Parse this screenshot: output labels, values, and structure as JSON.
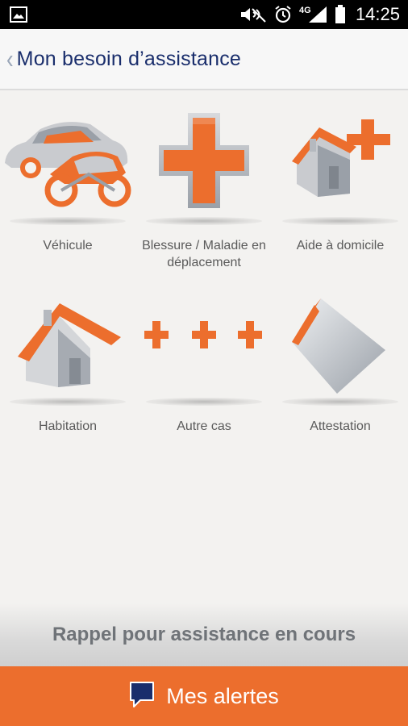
{
  "status_bar": {
    "time": "14:25",
    "network": "4G",
    "icons": [
      "image-icon",
      "mute-icon",
      "alarm-icon",
      "signal-icon",
      "battery-icon"
    ]
  },
  "header": {
    "back_icon": "chevron-left-icon",
    "title": "Mon besoin d’assistance"
  },
  "tiles": [
    {
      "label": "Véhicule",
      "icon": "vehicle-icon"
    },
    {
      "label": "Blessure / Maladie en déplacement",
      "icon": "medical-cross-icon"
    },
    {
      "label": "Aide à domicile",
      "icon": "home-help-icon"
    },
    {
      "label": "Habitation",
      "icon": "house-icon"
    },
    {
      "label": "Autre cas",
      "icon": "crosses-icon"
    },
    {
      "label": "Attestation",
      "icon": "document-icon"
    }
  ],
  "recall_text": "Rappel pour assistance en cours",
  "alerts_button": {
    "label": "Mes alertes",
    "icon": "chat-bubble-icon"
  },
  "colors": {
    "accent": "#ec6e2d",
    "title": "#1a2e6c",
    "background": "#f3f2f0"
  }
}
